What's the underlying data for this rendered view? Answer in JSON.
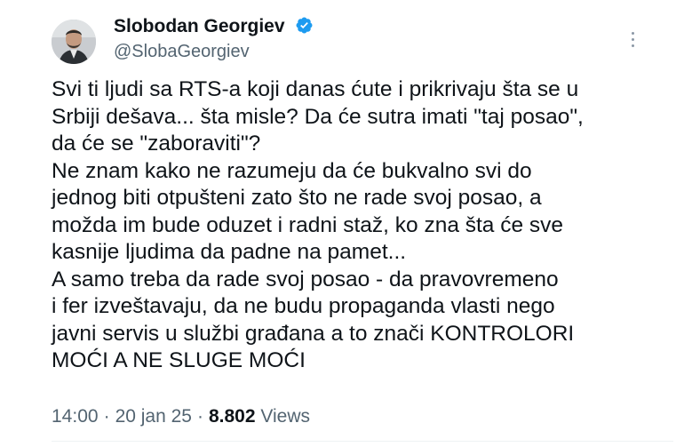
{
  "author": {
    "name": "Slobodan Georgiev",
    "handle": "@SlobaGeorgiev",
    "verified_icon": "verified-badge-icon"
  },
  "tweet": {
    "lines": [
      "Svi ti ljudi sa RTS-a koji danas ćute i prikrivaju šta se u",
      "Srbiji dešava... šta misle? Da će sutra imati \"taj posao\",",
      "da će se \"zaboraviti\"?",
      "Ne znam kako ne razumeju da će bukvalno svi do",
      "jednog biti otpušteni zato što ne rade svoj posao, a",
      "možda im bude oduzet i radni staž, ko zna šta će sve",
      "kasnije ljudima da padne na pamet...",
      "A samo treba da rade svoj posao - da pravovremeno",
      "i fer izveštavaju, da ne budu propaganda vlasti nego",
      "javni servis u službi građana a to znači KONTROLORI",
      "MOĆI A NE SLUGE MOĆI"
    ]
  },
  "meta": {
    "time": "14:00",
    "separator": "·",
    "date": "20 jan 25",
    "views_count": "8.802",
    "views_label": "Views"
  },
  "colors": {
    "text": "#0f1419",
    "secondary": "#536471",
    "verified": "#1d9bf0"
  }
}
